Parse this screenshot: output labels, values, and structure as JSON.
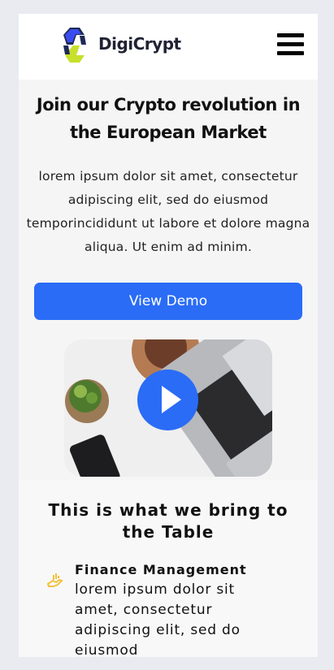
{
  "header": {
    "brand": "DigiCrypt",
    "menu_icon": "hamburger-menu-icon",
    "logo_colors": [
      "#1f2a55",
      "#3a4cf0",
      "#c7e02b"
    ]
  },
  "hero": {
    "title": "Join our Crypto revolution in the European Market",
    "text": "lorem ipsum dolor sit amet, consectetur adipiscing elit, sed do eiusmod temporincididunt ut labore et dolore magna aliqua. Ut enim ad minim.",
    "button": "View Demo",
    "video_icon": "play-icon"
  },
  "features": {
    "heading": "This is what we bring to the Table",
    "items": [
      {
        "icon": "finance-hand-icon",
        "title": "Finance Management",
        "text": "lorem ipsum dolor sit amet, consectetur adipiscing elit, sed do eiusmod"
      }
    ]
  },
  "colors": {
    "accent": "#2a6cf6",
    "icon_yellow": "#f3c23c"
  }
}
